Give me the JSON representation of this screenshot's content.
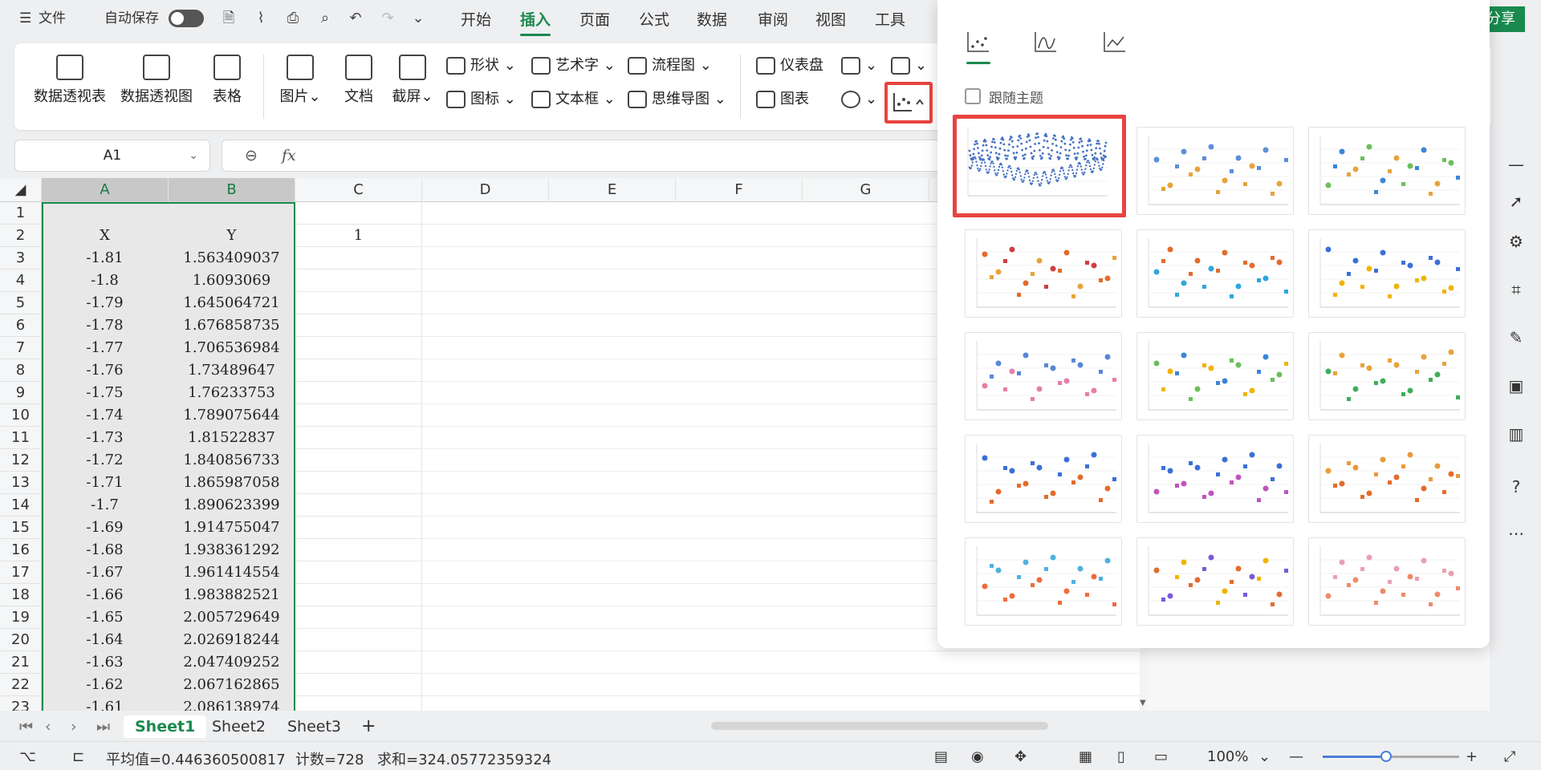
{
  "topbar": {
    "file_label": "文件",
    "autosave_label": "自动保存",
    "menu_tabs": [
      "开始",
      "插入",
      "页面",
      "公式",
      "数据",
      "审阅",
      "视图",
      "工具"
    ],
    "share_label": "分享"
  },
  "ribbon": {
    "pivot_table": "数据透视表",
    "pivot_chart": "数据透视图",
    "table": "表格",
    "picture": "图片",
    "document": "文档",
    "screenshot": "截屏",
    "shapes": "形状",
    "wordart": "艺术字",
    "flowchart": "流程图",
    "icons": "图标",
    "textbox": "文本框",
    "mindmap": "思维导图",
    "dashboard": "仪表盘",
    "chart": "图表"
  },
  "formula_bar": {
    "name_box": "A1",
    "fx": "fx",
    "content": ""
  },
  "sheet": {
    "columns": [
      "A",
      "B",
      "C",
      "D",
      "E",
      "F",
      "G"
    ],
    "rows": [
      {
        "n": "1",
        "a": "",
        "b": "",
        "c": ""
      },
      {
        "n": "2",
        "a": "X",
        "b": "Y",
        "c": "1"
      },
      {
        "n": "3",
        "a": "-1.81",
        "b": "1.563409037",
        "c": ""
      },
      {
        "n": "4",
        "a": "-1.8",
        "b": "1.6093069",
        "c": ""
      },
      {
        "n": "5",
        "a": "-1.79",
        "b": "1.645064721",
        "c": ""
      },
      {
        "n": "6",
        "a": "-1.78",
        "b": "1.676858735",
        "c": ""
      },
      {
        "n": "7",
        "a": "-1.77",
        "b": "1.706536984",
        "c": ""
      },
      {
        "n": "8",
        "a": "-1.76",
        "b": "1.73489647",
        "c": ""
      },
      {
        "n": "9",
        "a": "-1.75",
        "b": "1.76233753",
        "c": ""
      },
      {
        "n": "10",
        "a": "-1.74",
        "b": "1.789075644",
        "c": ""
      },
      {
        "n": "11",
        "a": "-1.73",
        "b": "1.81522837",
        "c": ""
      },
      {
        "n": "12",
        "a": "-1.72",
        "b": "1.840856733",
        "c": ""
      },
      {
        "n": "13",
        "a": "-1.71",
        "b": "1.865987058",
        "c": ""
      },
      {
        "n": "14",
        "a": "-1.7",
        "b": "1.890623399",
        "c": ""
      },
      {
        "n": "15",
        "a": "-1.69",
        "b": "1.914755047",
        "c": ""
      },
      {
        "n": "16",
        "a": "-1.68",
        "b": "1.938361292",
        "c": ""
      },
      {
        "n": "17",
        "a": "-1.67",
        "b": "1.961414554",
        "c": ""
      },
      {
        "n": "18",
        "a": "-1.66",
        "b": "1.983882521",
        "c": ""
      },
      {
        "n": "19",
        "a": "-1.65",
        "b": "2.005729649",
        "c": ""
      },
      {
        "n": "20",
        "a": "-1.64",
        "b": "2.026918244",
        "c": ""
      },
      {
        "n": "21",
        "a": "-1.63",
        "b": "2.047409252",
        "c": ""
      },
      {
        "n": "22",
        "a": "-1.62",
        "b": "2.067162865",
        "c": ""
      },
      {
        "n": "23",
        "a": "-1.61",
        "b": "2.086138974",
        "c": ""
      }
    ]
  },
  "sheet_tabs": [
    "Sheet1",
    "Sheet2",
    "Sheet3"
  ],
  "status": {
    "average": "平均值=0.446360500817",
    "count": "计数=728",
    "sum": "求和=324.05772359324",
    "zoom": "100%"
  },
  "chart_popup": {
    "follow_theme_label": "跟随主题",
    "follow_theme_checked": false,
    "thumbnail_count": 15,
    "selected_index": 0
  },
  "colors": {
    "accent": "#1a8a4e",
    "highlight": "#e8433e"
  }
}
